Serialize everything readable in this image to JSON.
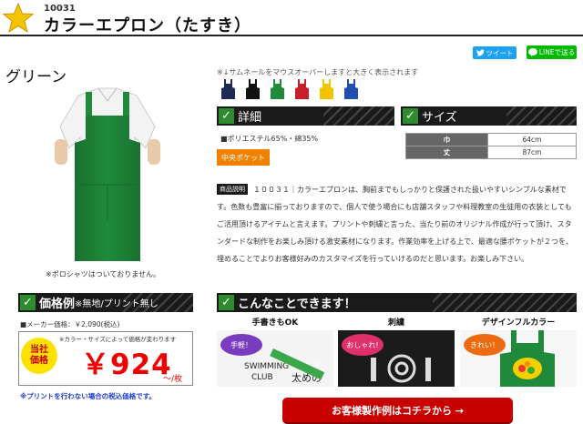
{
  "header": {
    "product_code": "10031",
    "title": "カラーエプロン（たすき）"
  },
  "share": {
    "tweet_label": "ツイート",
    "line_label": "LINEで送る"
  },
  "color_name": "グリーン",
  "photo_note": "※ポロシャツはついておりません。",
  "thumb_note": "※↓サムネールをマウスオーバーしますと大きく表示されます",
  "swatches": [
    {
      "color": "#1e2a55",
      "name": "navy"
    },
    {
      "color": "#111111",
      "name": "black"
    },
    {
      "color": "#1f8a3a",
      "name": "green"
    },
    {
      "color": "#c81e2a",
      "name": "red"
    },
    {
      "color": "#f2c400",
      "name": "yellow"
    },
    {
      "color": "#1f4fb0",
      "name": "blue"
    }
  ],
  "details": {
    "heading": "詳細",
    "material": "■ポリエステル65%・綿35%",
    "pocket_label": "中央ポケット"
  },
  "size": {
    "heading": "サイズ",
    "rows": [
      {
        "key": "巾",
        "value": "64cm"
      },
      {
        "key": "丈",
        "value": "87cm"
      }
    ]
  },
  "description": {
    "tag": "商品説明",
    "text": "１００３１｜カラーエプロンは、胸前までもしっかりと保護された扱いやすいシンプルな素材です。色数も豊富に揃っておりますので、個人で使う場合にも店舗スタッフや料理教室の生徒用の衣装としてもご活用頂けるアイテムと言えます。プリントや刺繍と言った、当たり前のオリジナル作成が行って頂け、スタンダードな制作をお楽しみ頂ける激安素材になります。作業効率を上げる上で、最適な腰ポケットが２つを、埋めることでよりお客様好みのカスタマイズを行っていけるのだと思います。お楽しみ下さい。"
  },
  "price_section": {
    "heading": "価格例",
    "heading_sub": "※無地/プリント無し",
    "maker_price": "■メーカー価格：￥2,090(税込)",
    "note": "※カラー・サイズによって価格が変わります",
    "badge": "当社価格",
    "price": "￥924",
    "per": "～/枚",
    "print_note": "※プリントを行わない場合の税込価格です。"
  },
  "features": {
    "heading": "こんなことできます！",
    "items": [
      {
        "title": "手書きもOK",
        "bubble": "手軽！",
        "bubble_color": "#7a3cbf"
      },
      {
        "title": "刺繍",
        "bubble": "おしゃれ!",
        "bubble_color": "#e0306a"
      },
      {
        "title": "デザインフルカラー",
        "bubble": "きれい！",
        "bubble_color": "#ee6a10"
      }
    ],
    "sample_text_1": "SWIMMING",
    "sample_text_2": "CLUB",
    "sample_text_3": "太めの",
    "sample_text_4": "HB"
  },
  "cta_label": "お客様製作例はコチラから →",
  "colors": {
    "accent_green": "#2e8b2e",
    "price_red": "#e00000",
    "cta_red": "#c80000",
    "badge_yellow": "#ffe100"
  }
}
